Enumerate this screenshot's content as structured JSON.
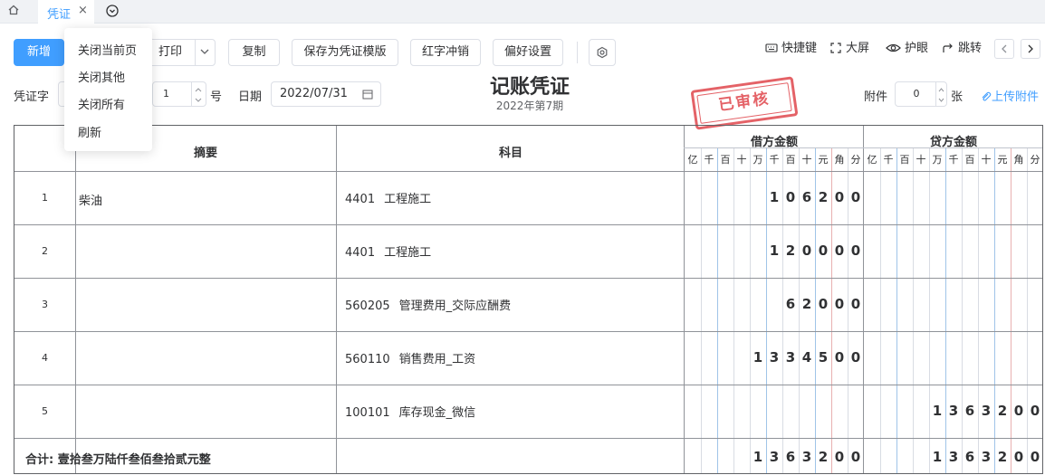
{
  "tabs": {
    "active_label": "凭证",
    "close_glyph": "×"
  },
  "toolbar": {
    "add": "新增",
    "print": "打印",
    "copy": "复制",
    "save_template": "保存为凭证模版",
    "red_reverse": "红字冲销",
    "preferences": "偏好设置",
    "shortcuts": "快捷键",
    "big_screen": "大屏",
    "eye_care": "护眼",
    "jump": "跳转"
  },
  "context_menu": [
    "关闭当前页",
    "关闭其他",
    "关闭所有",
    "刷新"
  ],
  "voucher": {
    "word_label": "凭证字",
    "number": "1",
    "number_suffix": "号",
    "date_label": "日期",
    "date": "2022/07/31",
    "title": "记账凭证",
    "period": "2022年第7期",
    "stamp": "已审核",
    "attach_label": "附件",
    "attach_count": "0",
    "attach_unit": "张",
    "upload": "上传附件"
  },
  "table": {
    "col_summary": "摘要",
    "col_subject": "科目",
    "col_debit": "借方金额",
    "col_credit": "贷方金额",
    "units": [
      "亿",
      "千",
      "百",
      "十",
      "万",
      "千",
      "百",
      "十",
      "元",
      "角",
      "分"
    ],
    "rows": [
      {
        "no": "1",
        "summary": "柴油",
        "code": "4401",
        "name": "工程施工",
        "debit": "106200",
        "credit": ""
      },
      {
        "no": "2",
        "summary": "",
        "code": "4401",
        "name": "工程施工",
        "debit": "120000",
        "credit": ""
      },
      {
        "no": "3",
        "summary": "",
        "code": "560205",
        "name": "管理费用_交际应酬费",
        "debit": "62000",
        "credit": ""
      },
      {
        "no": "4",
        "summary": "",
        "code": "560110",
        "name": "销售费用_工资",
        "debit": "1334500",
        "credit": ""
      },
      {
        "no": "5",
        "summary": "",
        "code": "100101",
        "name": "库存现金_微信",
        "debit": "",
        "credit": "1363200"
      }
    ],
    "total_label": "合计: 壹拾叁万陆仟叁佰叁拾贰元整",
    "total_debit": "1363200",
    "total_credit": "1363200"
  },
  "colors": {
    "accent": "#409eff",
    "stamp": "#e0474d"
  }
}
